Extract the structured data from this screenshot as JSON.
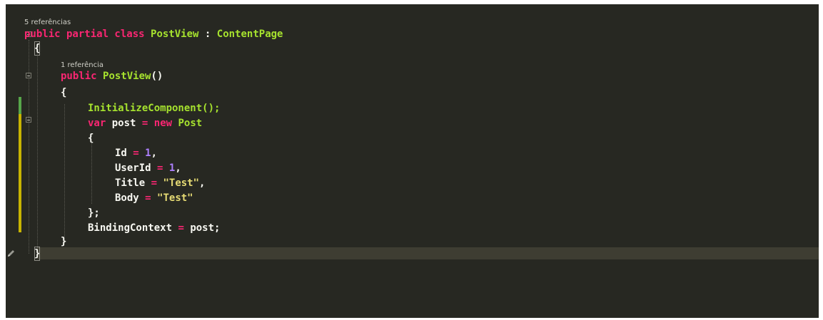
{
  "editor": {
    "theme": {
      "background": "#272822",
      "keyword": "#f92672",
      "type": "#a6e22e",
      "number": "#ae81ff",
      "string": "#e6db74",
      "text": "#f8f8f2",
      "saved_change": "#57a64a",
      "unsaved_change": "#c8b400"
    },
    "codelens": {
      "class_refs": "5 referências",
      "ctor_refs": "1 referência"
    },
    "code": {
      "l1_kw": "public partial class",
      "l1_name": "PostView",
      "l1_colon": ":",
      "l1_base": "ContentPage",
      "l2": "{",
      "l3_kw": "public",
      "l3_name": "PostView",
      "l3_paren": "()",
      "l4": "{",
      "l5": "InitializeComponent();",
      "l6_var": "var",
      "l6_post": "post",
      "l6_eq": "=",
      "l6_new": "new",
      "l6_type": "Post",
      "l7": "{",
      "l8_name": "Id",
      "l8_eq": "=",
      "l8_val": "1",
      "l8_comma": ",",
      "l9_name": "UserId",
      "l9_eq": "=",
      "l9_val": "1",
      "l9_comma": ",",
      "l10_name": "Title",
      "l10_eq": "=",
      "l10_val": "\"Test\"",
      "l10_comma": ",",
      "l11_name": "Body",
      "l11_eq": "=",
      "l11_val": "\"Test\"",
      "l12": "};",
      "l13_name": "BindingContext",
      "l13_eq": "=",
      "l13_val": "post;",
      "l14": "}",
      "l15": "}"
    },
    "icons": [
      "fold-collapse-icon",
      "pencil-edit-icon"
    ]
  }
}
